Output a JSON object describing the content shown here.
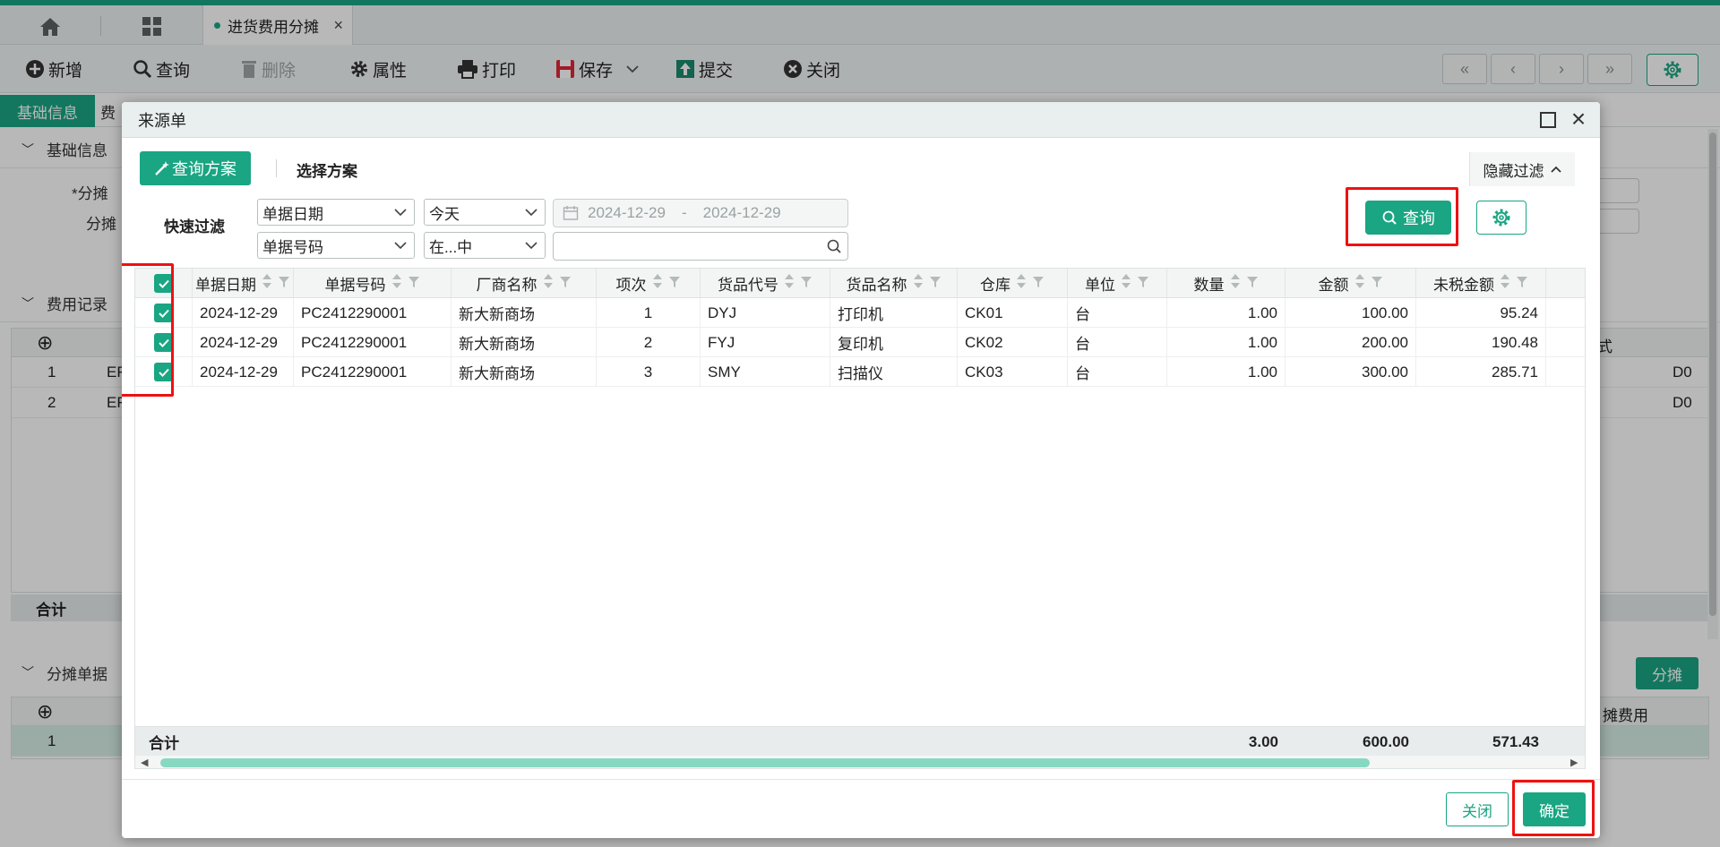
{
  "tabbar": {
    "doc_tab_label": "进货费用分摊",
    "doc_tab_close": "×"
  },
  "toolbar": {
    "new_label": "新增",
    "query_label": "查询",
    "delete_label": "删除",
    "properties_label": "属性",
    "print_label": "打印",
    "save_label": "保存",
    "submit_label": "提交",
    "close_label": "关闭"
  },
  "background": {
    "tab_basic": "基础信息",
    "tab_fee": "费",
    "section_basic": "基础信息",
    "field_1_label": "*分摊",
    "field_2_label": "分摊",
    "section_fee": "费用记录",
    "fee_rows": [
      {
        "no": "1",
        "code": "EF",
        "right": "D0"
      },
      {
        "no": "2",
        "code": "EF",
        "right": "D0"
      }
    ],
    "fee_header_right": "式",
    "fee_total": "合计",
    "section_alloc": "分摊单据",
    "alloc_button": "分摊",
    "alloc_header_right": "摊费用",
    "alloc_row_no": "1"
  },
  "modal": {
    "title": "来源单",
    "query_plan_button": "查询方案",
    "select_plan_label": "选择方案",
    "hide_filter_button": "隐藏过滤",
    "quick_filter_label": "快速过滤",
    "filter_rows": [
      {
        "field": "单据日期",
        "operator": "今天",
        "date_from": "2024-12-29",
        "date_sep": "-",
        "date_to": "2024-12-29"
      },
      {
        "field": "单据号码",
        "operator": "在...中",
        "value": ""
      }
    ],
    "query_button": "查询",
    "columns": [
      "单据日期",
      "单据号码",
      "厂商名称",
      "项次",
      "货品代号",
      "货品名称",
      "仓库",
      "单位",
      "数量",
      "金额",
      "未税金额"
    ],
    "rows": [
      {
        "checked": true,
        "date": "2024-12-29",
        "doc_no": "PC2412290001",
        "vendor": "新大新商场",
        "item_no": "1",
        "goods_code": "DYJ",
        "goods_name": "打印机",
        "warehouse": "CK01",
        "unit": "台",
        "qty": "1.00",
        "amount": "100.00",
        "untaxed": "95.24"
      },
      {
        "checked": true,
        "date": "2024-12-29",
        "doc_no": "PC2412290001",
        "vendor": "新大新商场",
        "item_no": "2",
        "goods_code": "FYJ",
        "goods_name": "复印机",
        "warehouse": "CK02",
        "unit": "台",
        "qty": "1.00",
        "amount": "200.00",
        "untaxed": "190.48"
      },
      {
        "checked": true,
        "date": "2024-12-29",
        "doc_no": "PC2412290001",
        "vendor": "新大新商场",
        "item_no": "3",
        "goods_code": "SMY",
        "goods_name": "扫描仪",
        "warehouse": "CK03",
        "unit": "台",
        "qty": "1.00",
        "amount": "300.00",
        "untaxed": "285.71"
      }
    ],
    "total": {
      "label": "合计",
      "qty": "3.00",
      "amount": "600.00",
      "untaxed": "571.43"
    },
    "close_button": "关闭",
    "ok_button": "确定"
  },
  "colors": {
    "accent": "#1aa583",
    "highlight_box": "#ee1111"
  }
}
